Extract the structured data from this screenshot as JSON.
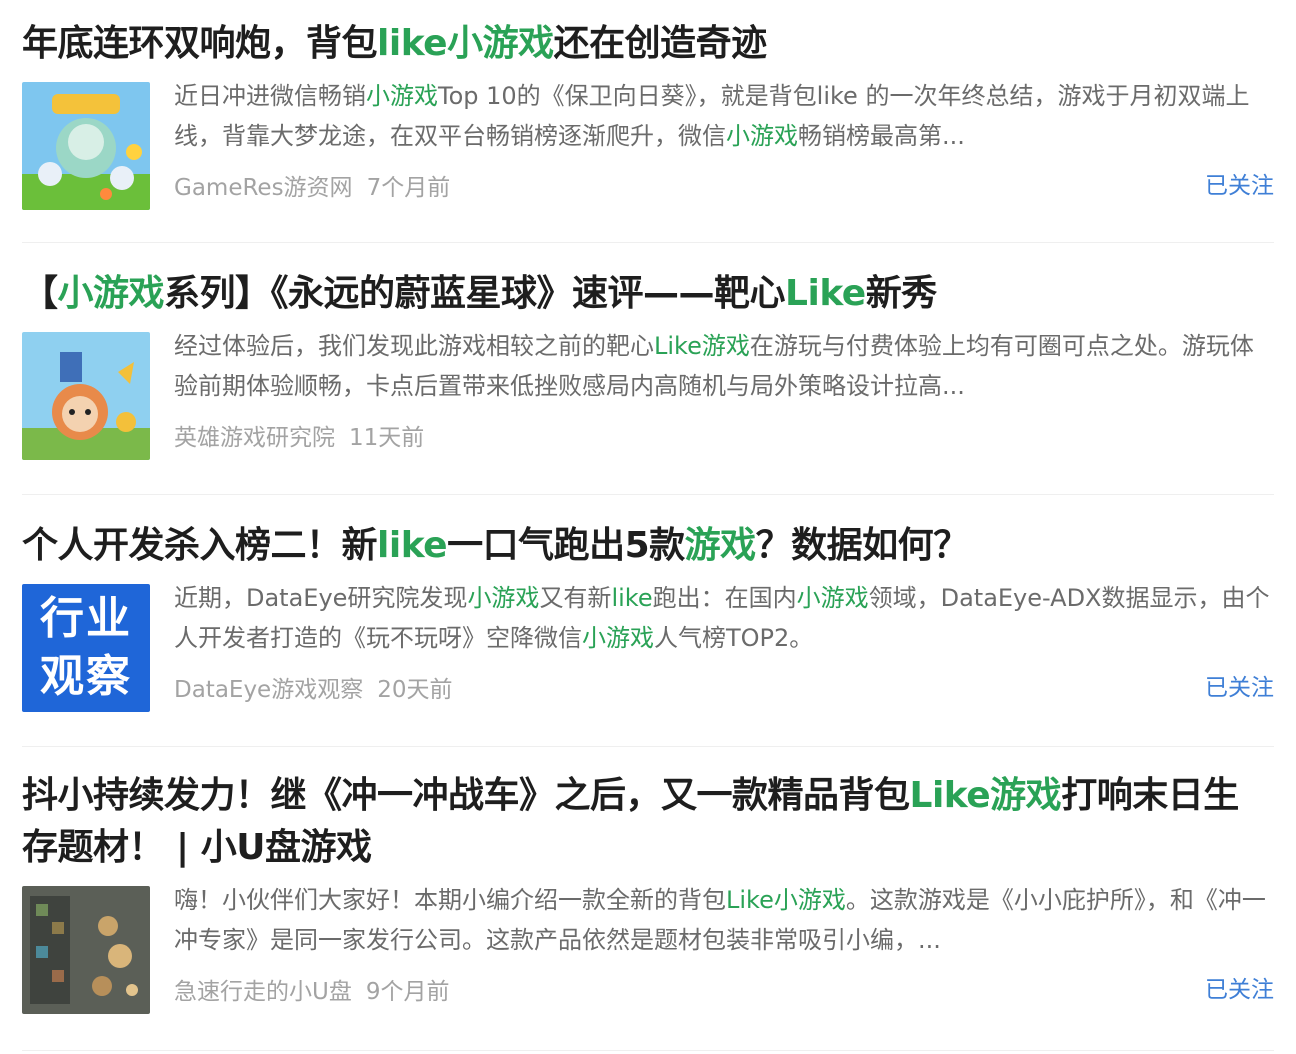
{
  "articles": [
    {
      "title_parts": [
        {
          "text": "年底连环双响炮，背包",
          "hl": false
        },
        {
          "text": "like小游戏",
          "hl": true
        },
        {
          "text": "还在创造奇迹",
          "hl": false
        }
      ],
      "summary_parts": [
        {
          "text": "近日冲进微信畅销",
          "hl": false
        },
        {
          "text": "小游戏",
          "hl": true
        },
        {
          "text": "Top 10的《保卫向日葵》，就是背包like 的一次年终总结，游戏于月初双端上线，背靠大梦龙途，在双平台畅销榜逐渐爬升，微信",
          "hl": false
        },
        {
          "text": "小游戏",
          "hl": true
        },
        {
          "text": "畅销榜最高第...",
          "hl": false
        }
      ],
      "source": "GameRes游资网",
      "time": "7个月前",
      "follow": "已关注",
      "thumb_icon": "game-art-sunflower-icon"
    },
    {
      "title_parts": [
        {
          "text": "【",
          "hl": false
        },
        {
          "text": "小游戏",
          "hl": true
        },
        {
          "text": "系列】《永远的蔚蓝星球》速评——靶心",
          "hl": false
        },
        {
          "text": "Like",
          "hl": true
        },
        {
          "text": "新秀",
          "hl": false
        }
      ],
      "summary_parts": [
        {
          "text": "经过体验后，我们发现此游戏相较之前的靶心",
          "hl": false
        },
        {
          "text": "Like游戏",
          "hl": true
        },
        {
          "text": "在游玩与付费体验上均有可圈可点之处。游玩体验前期体验顺畅，卡点后置带来低挫败感局内高随机与局外策略设计拉高...",
          "hl": false
        }
      ],
      "source": "英雄游戏研究院",
      "time": "11天前",
      "follow": "",
      "thumb_icon": "game-art-hero-icon"
    },
    {
      "title_parts": [
        {
          "text": "个人开发杀入榜二！新",
          "hl": false
        },
        {
          "text": "like",
          "hl": true
        },
        {
          "text": "一口气跑出5款",
          "hl": false
        },
        {
          "text": "游戏",
          "hl": true
        },
        {
          "text": "？数据如何？",
          "hl": false
        }
      ],
      "summary_parts": [
        {
          "text": "近期，DataEye研究院发现",
          "hl": false
        },
        {
          "text": "小游戏",
          "hl": true
        },
        {
          "text": "又有新",
          "hl": false
        },
        {
          "text": "like",
          "hl": true
        },
        {
          "text": "跑出：在国内",
          "hl": false
        },
        {
          "text": "小游戏",
          "hl": true
        },
        {
          "text": "领域，DataEye-ADX数据显示，由个人开发者打造的《玩不玩呀》空降微信",
          "hl": false
        },
        {
          "text": "小游戏",
          "hl": true
        },
        {
          "text": "人气榜TOP2。",
          "hl": false
        }
      ],
      "source": "DataEye游戏观察",
      "time": "20天前",
      "follow": "已关注",
      "thumb_text": [
        "行业",
        "观察"
      ]
    },
    {
      "title_parts": [
        {
          "text": "抖小持续发力！继《冲一冲战车》之后，又一款精品背包",
          "hl": false
        },
        {
          "text": "Like游戏",
          "hl": true
        },
        {
          "text": "打响末日生存题材！ | 小U盘游戏",
          "hl": false
        }
      ],
      "summary_parts": [
        {
          "text": "嗨！小伙伴们大家好！本期小编介绍一款全新的背包",
          "hl": false
        },
        {
          "text": "Like小游戏",
          "hl": true
        },
        {
          "text": "。这款游戏是《小小庇护所》，和《冲一冲专家》是同一家发行公司。这款产品依然是题材包装非常吸引小编，...",
          "hl": false
        }
      ],
      "source": "急速行走的小U盘",
      "time": "9个月前",
      "follow": "已关注",
      "thumb_icon": "game-screenshot-icon"
    }
  ],
  "colors": {
    "highlight": "#2aa256",
    "follow": "#3f7fd6",
    "meta": "#a3a3a3"
  }
}
